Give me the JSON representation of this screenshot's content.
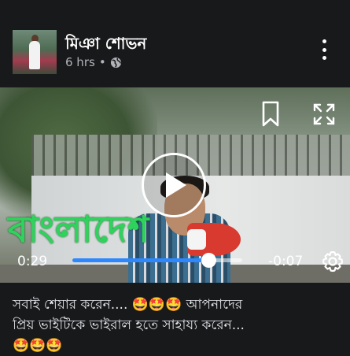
{
  "post": {
    "author_name": "মিঞা শোভন",
    "timestamp": "6 hrs",
    "separator": "•",
    "privacy_icon": "globe-icon",
    "more_icon": "more-vertical-icon"
  },
  "video": {
    "overlay_caption": "বাংলাদেশ",
    "time_elapsed": "0:29",
    "time_remaining": "-0:07",
    "progress_fraction": 0.8,
    "icons": {
      "bookmark": "bookmark-icon",
      "fullscreen": "fullscreen-icon",
      "play": "play-icon",
      "settings": "settings-gear-icon"
    },
    "accent_color": "#2d88ff",
    "caption_color": "#2ed35c"
  },
  "caption": {
    "line1": "সবাই শেয়ার করেন.... 🤩🤩🤩  আপনাদের",
    "line2": "প্রিয় ভাইটিকে ভাইরাল হতে সাহায্য করেন...",
    "line3": "🤩🤩🤩"
  }
}
